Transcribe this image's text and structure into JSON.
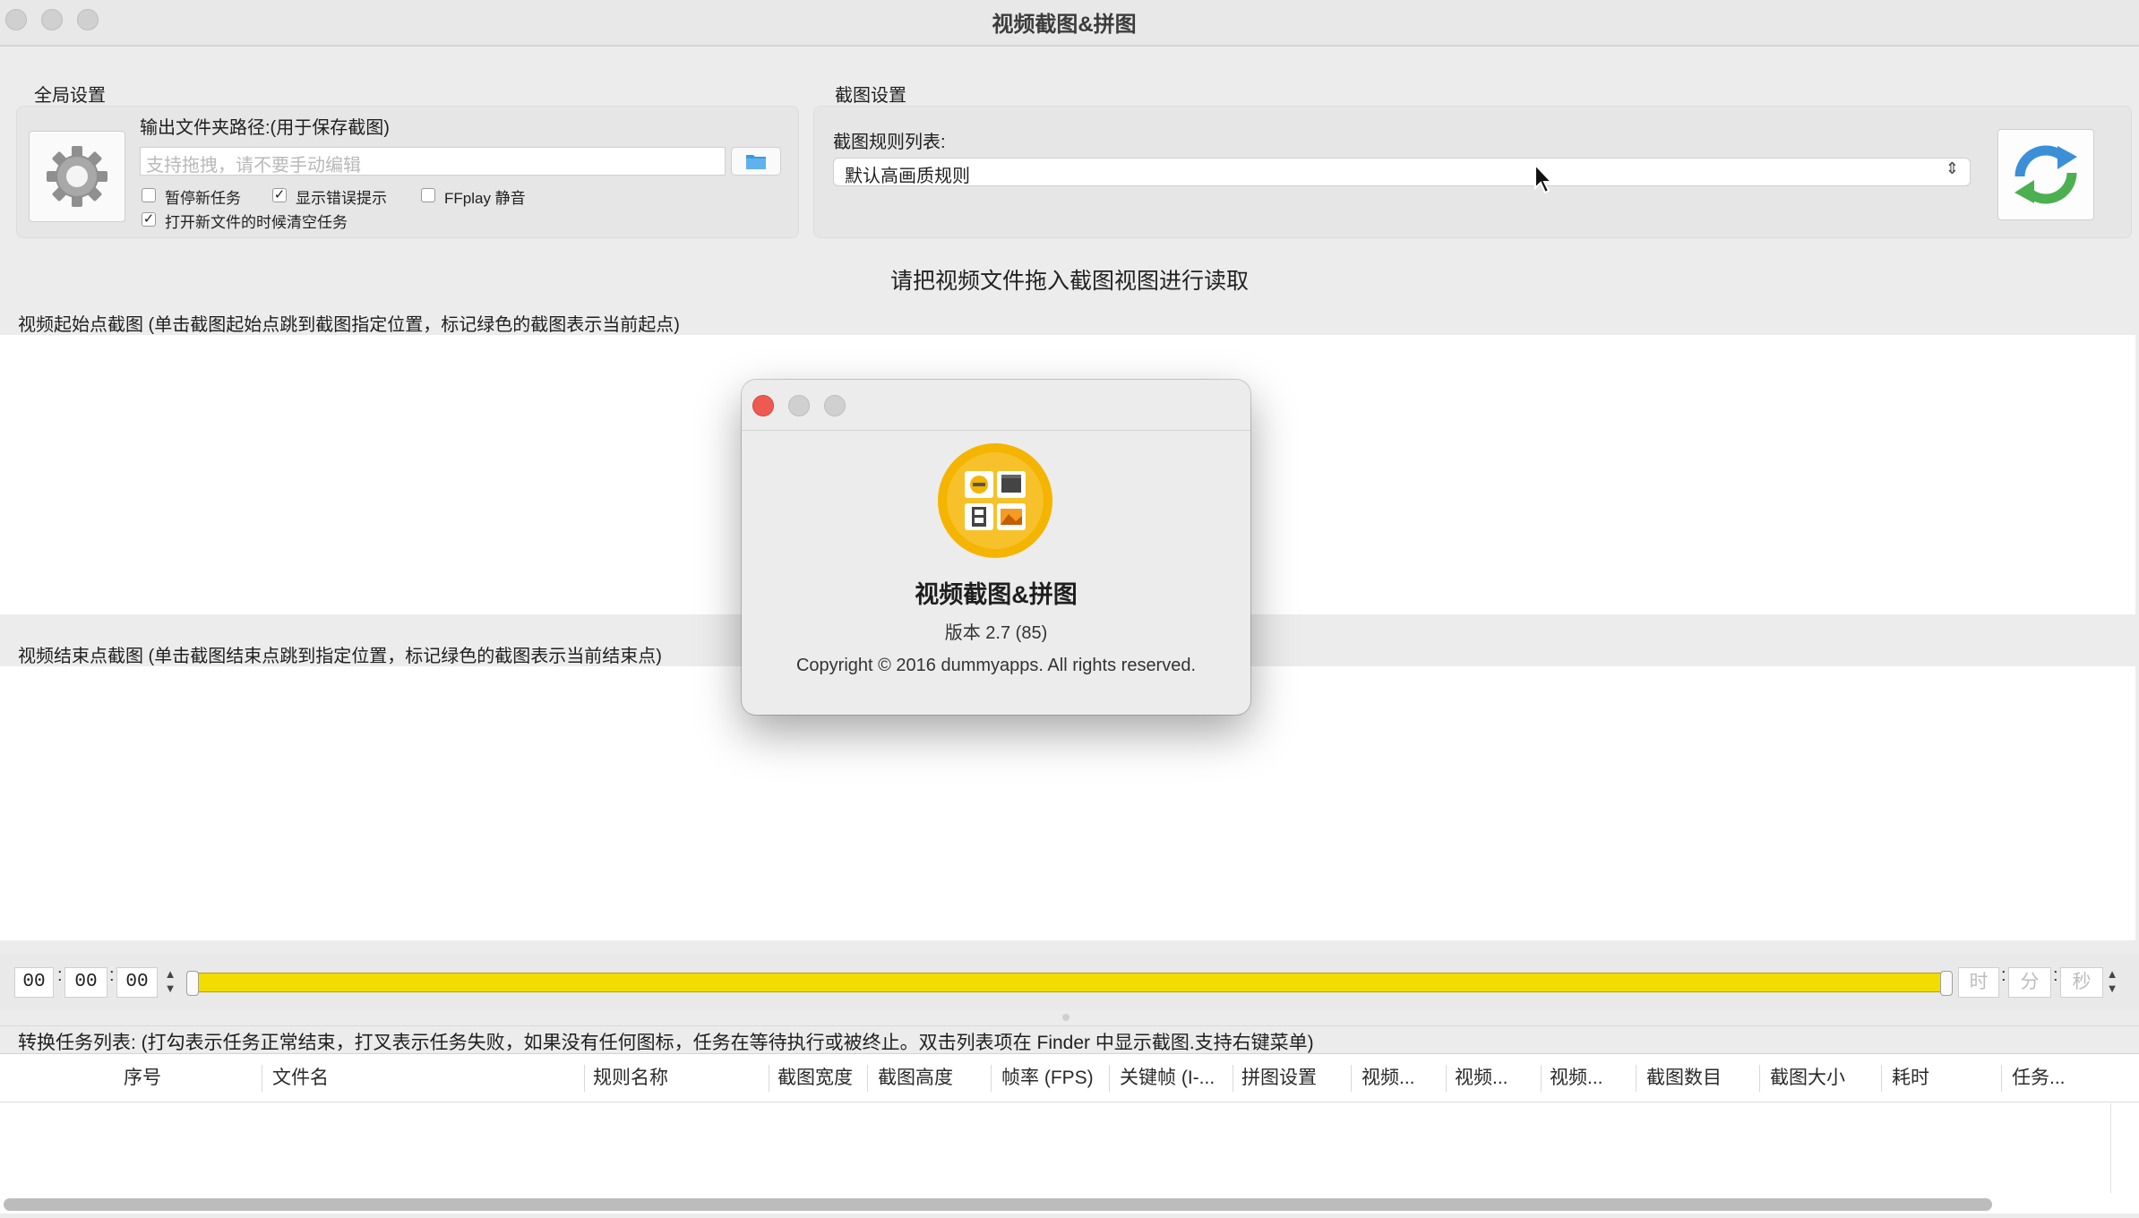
{
  "window": {
    "title": "视频截图&拼图"
  },
  "global_settings": {
    "section_title": "全局设置",
    "output_label": "输出文件夹路径:(用于保存截图)",
    "output_placeholder": "支持拖拽，请不要手动编辑",
    "checkboxes": [
      {
        "label": "暂停新任务",
        "checked": false
      },
      {
        "label": "显示错误提示",
        "checked": true
      },
      {
        "label": "FFplay 静音",
        "checked": false
      },
      {
        "label": "打开新文件的时候清空任务",
        "checked": true
      }
    ],
    "icons": {
      "settings": "gear-icon",
      "browse": "folder-icon"
    }
  },
  "capture_settings": {
    "section_title": "截图设置",
    "rule_list_label": "截图规则列表:",
    "rule_selected": "默认高画质规则",
    "icons": {
      "refresh": "refresh-icon"
    }
  },
  "main": {
    "instruction": "请把视频文件拖入截图视图进行读取",
    "start_frames_label": "视频起始点截图 (单击截图起始点跳到截图指定位置，标记绿色的截图表示当前起点)",
    "end_frames_label": "视频结束点截图 (单击截图结束点跳到指定位置，标记绿色的截图表示当前结束点)"
  },
  "timeline": {
    "start": {
      "h": "00",
      "m": "00",
      "s": "00"
    },
    "end_placeholders": {
      "h": "时",
      "m": "分",
      "s": "秒"
    },
    "range_start": 0.0,
    "range_end": 1.0,
    "track_color": "#f2dd00"
  },
  "tasks": {
    "label": "转换任务列表: (打勾表示任务正常结束，打叉表示任务失败，如果没有任何图标，任务在等待执行或被终止。双击列表项在 Finder 中显示截图.支持右键菜单)",
    "columns": [
      "序号",
      "文件名",
      "规则名称",
      "截图宽度",
      "截图高度",
      "帧率 (FPS)",
      "关键帧 (I-...",
      "拼图设置",
      "视频...",
      "视频...",
      "视频...",
      "截图数目",
      "截图大小",
      "耗时",
      "任务..."
    ],
    "rows": []
  },
  "about": {
    "app_name": "视频截图&拼图",
    "version": "版本 2.7 (85)",
    "copyright": "Copyright © 2016 dummyapps. All rights reserved.",
    "icon": "app-icon",
    "colors": {
      "close": "#ee5a52",
      "icon_bg": "#f4b400"
    }
  }
}
